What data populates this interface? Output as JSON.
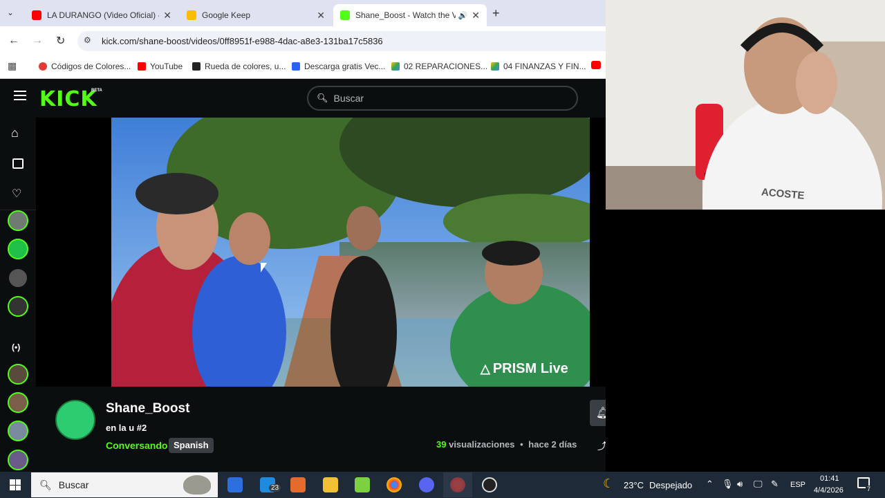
{
  "browser": {
    "tabs": [
      {
        "title": "LA DURANGO (Video Oficial) - Y",
        "color": "#ff0000"
      },
      {
        "title": "Google Keep",
        "color": "#fbbc04"
      },
      {
        "title": "Shane_Boost - Watch the VOD",
        "color": "#53fc18"
      }
    ],
    "url": "kick.com/shane-boost/videos/0ff8951f-e988-4dac-a8e3-131ba17c5836",
    "bookmarks": [
      {
        "label": "Códigos de Colores...",
        "color": "#e53935"
      },
      {
        "label": "YouTube",
        "color": "#ff0000"
      },
      {
        "label": "Rueda de colores, u...",
        "color": "#222222"
      },
      {
        "label": "Descarga gratis Vec...",
        "color": "#2962ff"
      },
      {
        "label": "02 REPARACIONES...",
        "color": "#34a853"
      },
      {
        "label": "04 FINANZAS Y FIN...",
        "color": "#34a853"
      }
    ]
  },
  "kick": {
    "logo": "KICK",
    "beta": "BETA",
    "search_placeholder": "Buscar",
    "video_watermark": "PRISM Live",
    "channel_name": "Shane_Boost",
    "stream_title": "en la u #2",
    "category": "Conversando",
    "language": "Spanish",
    "views_count": "39",
    "views_label": "visualizaciones",
    "separator": "•",
    "time_ago": "hace 2 días",
    "accent": "#53fc18"
  },
  "webcam": {
    "shirt_text": "ACOSTE"
  },
  "taskbar": {
    "search_placeholder": "Buscar",
    "mail_badge": "23",
    "weather_temp": "23°C",
    "weather_desc": "Despejado",
    "language": "ESP",
    "time": "01:41",
    "date": "4/4/2026",
    "notif_count": "7"
  }
}
